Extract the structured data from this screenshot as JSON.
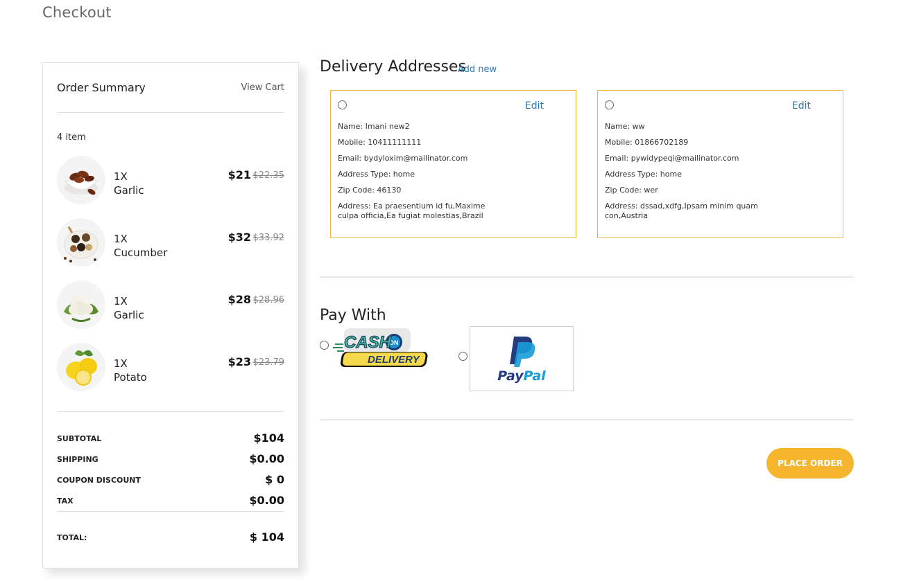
{
  "page": {
    "title": "Checkout"
  },
  "summary": {
    "title": "Order Summary",
    "view_cart": "View Cart",
    "item_count": "4 item",
    "items": [
      {
        "qty": "1X",
        "name": "Garlic",
        "price": "$21",
        "old_price": "$22.35",
        "image": "dates-bowl"
      },
      {
        "qty": "1X",
        "name": "Cucumber",
        "price": "$32",
        "old_price": "$33.92",
        "image": "spices-plate"
      },
      {
        "qty": "1X",
        "name": "Garlic",
        "price": "$28",
        "old_price": "$28.96",
        "image": "cauliflower"
      },
      {
        "qty": "1X",
        "name": "Potato",
        "price": "$23",
        "old_price": "$23.79",
        "image": "lemons"
      }
    ],
    "subtotal_label": "SUBTOTAL",
    "subtotal": "$104",
    "shipping_label": "SHIPPING",
    "shipping": "$0.00",
    "coupon_label": "COUPON DISCOUNT",
    "coupon": "$ 0",
    "tax_label": "TAX",
    "tax": "$0.00",
    "total_label": "TOTAL:",
    "total": "$ 104"
  },
  "delivery": {
    "title": "Delivery Addresses",
    "add_new": "Add new",
    "addresses": [
      {
        "edit": "Edit",
        "name": "Name: Imani new2",
        "mobile": "Mobile: 10411111111",
        "email": "Email: bydyloxim@mailinator.com",
        "type": "Address Type: home",
        "zip": "Zip Code: 46130",
        "address": "Address: Ea praesentium id fu,Maxime culpa officia,Ea fugiat molestias,Brazil"
      },
      {
        "edit": "Edit",
        "name": "Name: ww",
        "mobile": "Mobile: 01866702189",
        "email": "Email: pywidypeqi@mailinator.com",
        "type": "Address Type: home",
        "zip": "Zip Code: wer",
        "address": "Address: dssad,xdfg,Ipsam minim quam con,Austria"
      }
    ]
  },
  "payment": {
    "title": "Pay With",
    "cod": {
      "line1": "CASH",
      "badge": "ON",
      "line2": "DELIVERY"
    },
    "paypal": {
      "part1": "Pay",
      "part2": "Pal"
    }
  },
  "actions": {
    "place_order": "PLACE ORDER"
  },
  "colors": {
    "accent": "#f5b52f",
    "link": "#2a7ab8",
    "card_border": "#f1b53a"
  }
}
